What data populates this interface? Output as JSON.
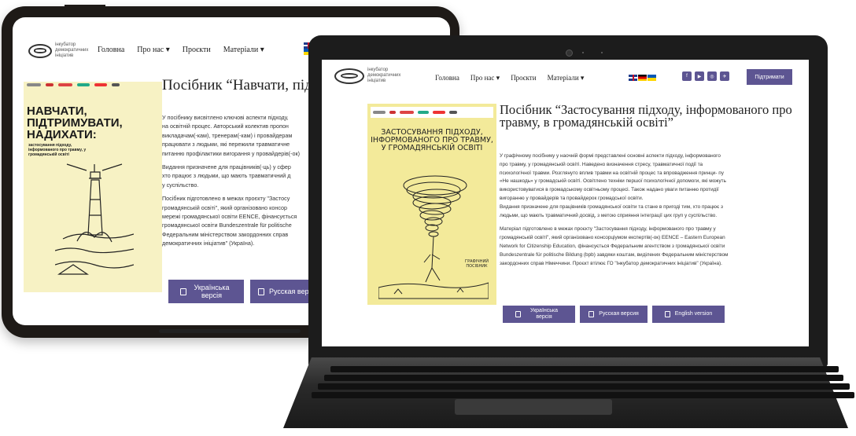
{
  "site": {
    "logo_text": "інкубатор демократичних ініціатив",
    "nav": [
      "Головна",
      "Про нас ▾",
      "Проєкти",
      "Матеріали ▾"
    ],
    "flags": [
      "uk",
      "de",
      "ua"
    ],
    "socials": [
      "f",
      "▶",
      "◎",
      "✈"
    ],
    "donate_label": "Підтримати"
  },
  "tablet_page": {
    "title": "Посібник “Навчати, підтримувати, надихати”",
    "cover_title": "НАВЧАТИ, ПІДТРИМУВАТИ, НАДИХАТИ:",
    "cover_subtitle": "застосування підходу, інформованого про травму, у громадянській освіті",
    "body_lines": [
      "У посібнику висвітлено ключові аспекти підходу,",
      "на освітній процес. Авторський колектив пропон",
      "викладачам(-кам), тренерам(-кам) і провайдерам",
      "працювати з людьми, які пережили травматичне",
      "питанню профілактики вигорання у провайдерів(-ок)"
    ],
    "body_lines_2": [
      "Видання призначене для працівників(-ць) у сфер",
      "хто працює з людьми, що мають травматичний д",
      "у суспільство."
    ],
    "body_lines_3": [
      "Посібник підготовлено в межах проєкту \"Застосу",
      "громадянській освіті\", який організовано консор",
      "мережі громадянської освіти EENCE, фінансується",
      "громадянської освіти Bundeszentrale für politische",
      "Федеральним міністерством закордонних справ",
      "демократичних ініціатив\" (Україна)."
    ],
    "buttons": [
      "Українська версія",
      "Русская версия"
    ]
  },
  "laptop_page": {
    "title": "Посібник “Застосування підходу, інформованого про травму, в громадянській освіті”",
    "cover_title": "ЗАСТОСУВАННЯ ПІДХОДУ, ІНФОРМОВАНОГО ПРО ТРАВМУ, У ГРОМАДЯНСЬКІЙ ОСВІТІ",
    "cover_tag": "ГРАФІЧНИЙ ПОСІБНИК",
    "para1": [
      "У графічному посібнику у наочній формі представлені основні аспекти підходу, інформованого",
      "про травму, у громадянській освіті. Наведено визначення стресу, травматичної події та",
      "психологічної травми. Розглянуто вплив травми на освітній процес та впровадження принци- пу",
      "«Не нашкодь» у громадській освіті. Освітлено техніки першої психологічної допомоги, які можуть",
      "використовуватися в громадському освітньому процесі. Також надано уваги питанню протидії",
      "вигоранню у провайдерів та провайдерок громадської освіти.",
      "Видання призначене для працівників громадянської освіти та стане в пригоді тим, хто працює з",
      "людьми, що мають травматичний досвід, з метою сприяння інтеграції цих груп у суспільство."
    ],
    "para2": [
      "Матеріал підготовлено в межах проєкту \"Застосування підходу, інформованого про травму у",
      "громадянській освіті\", який організовано консорціумом експертів(-ок) EENCE – Eastern European",
      "Network for Citizenship Education, фінансується Федеральним агентством з громадянської освіти",
      "Bundeszentrale für politische Bildung (bpb) завдяки коштам, виділених Федеральним міністерством",
      "закордонних справ Німеччини. Проєкт втілює ГО \"Інкубатор демократичних ініціатив\" (Україна)."
    ],
    "buttons": [
      "Українська версія",
      "Русская версия",
      "English version"
    ]
  },
  "colors": {
    "accent": "#5d5592",
    "cover_yellow": "#f3ea9a",
    "device_dark": "#1c1c1c"
  }
}
